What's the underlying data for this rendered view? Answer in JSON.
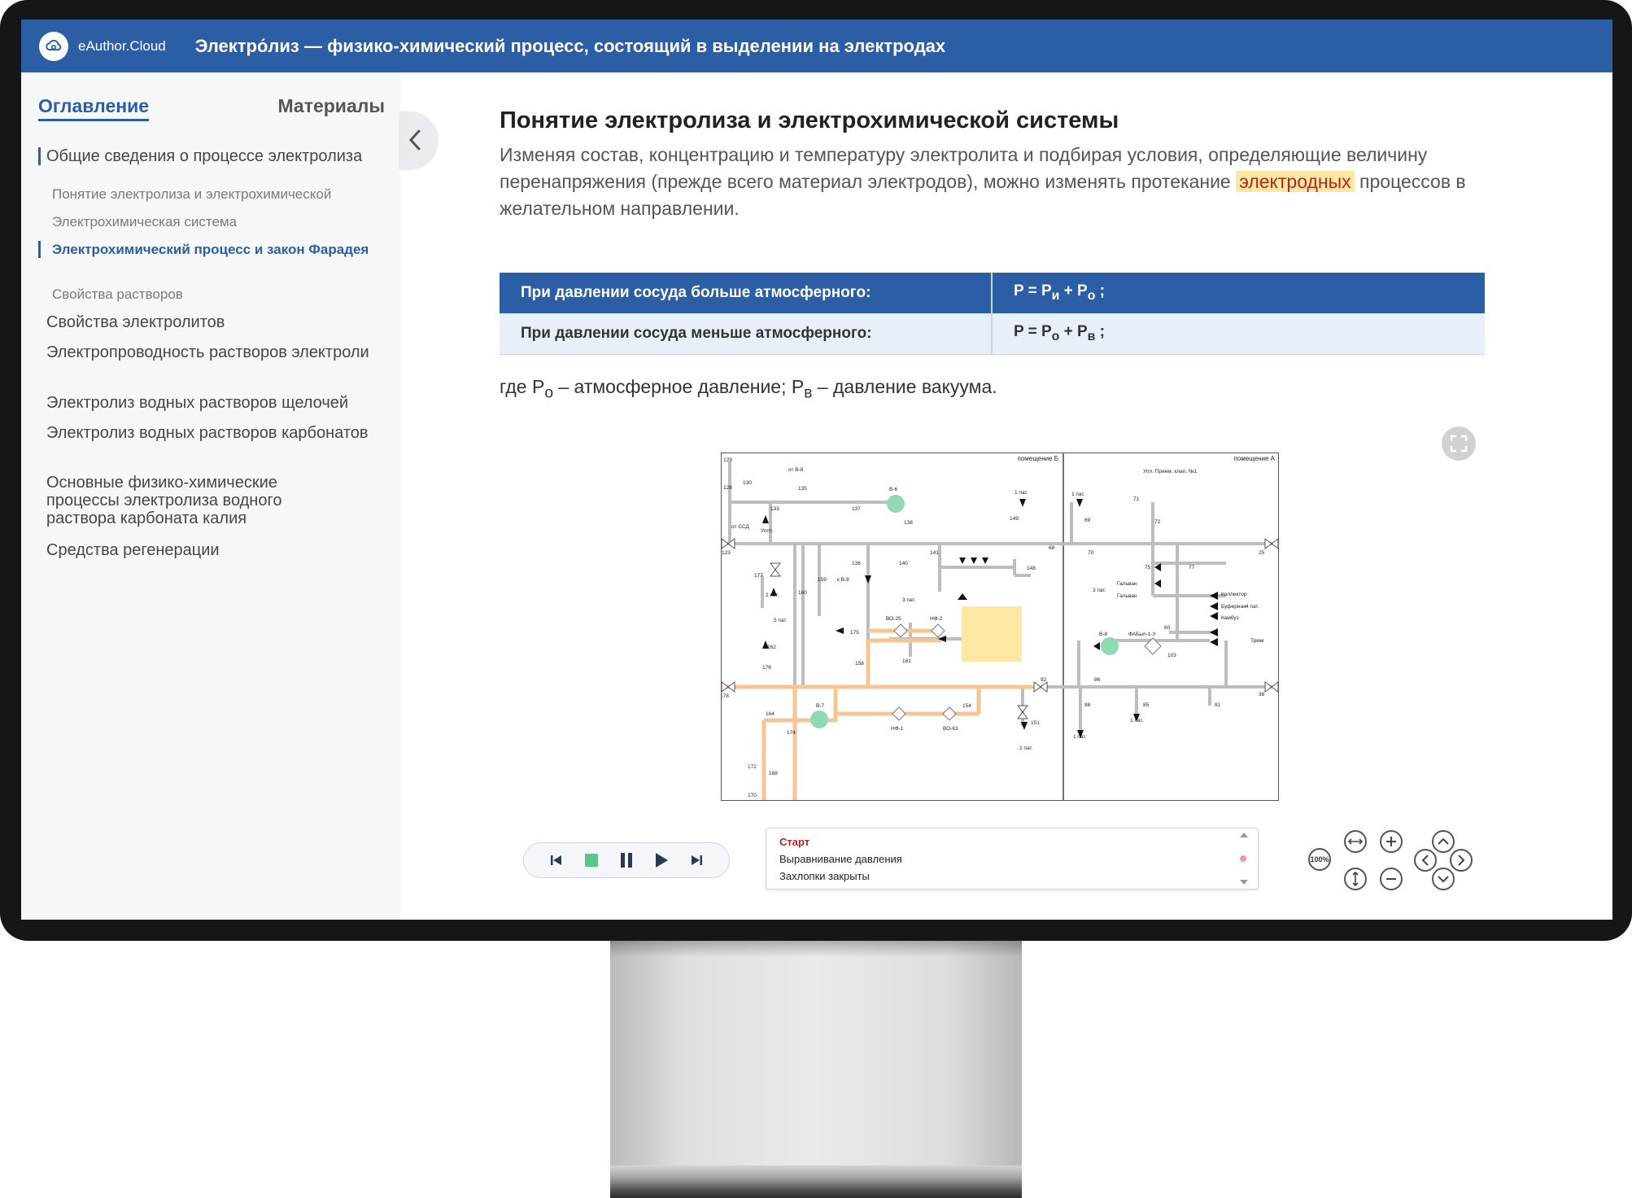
{
  "app": {
    "logo_text": "eAuthor.Cloud",
    "title": "Электро́лиз — физико-химический процесс, состоящий в выделении на электродах"
  },
  "sidebar": {
    "tabs": {
      "active": "Оглавление",
      "inactive": "Материалы"
    },
    "items": [
      {
        "label": "Общие сведения о процессе электролиза"
      },
      {
        "label": "Понятие электролиза и электрохимической"
      },
      {
        "label": "Электрохимическая система"
      },
      {
        "label": "Электрохимический процесс и закон Фарадея"
      },
      {
        "label": "Свойства растворов"
      },
      {
        "label": "Свойства электролитов"
      },
      {
        "label": "Электропроводность растворов электроли"
      },
      {
        "label": "Электролиз водных растворов щелочей"
      },
      {
        "label": "Электролиз водных растворов карбонатов"
      },
      {
        "label": "Основные физико-химические процессы электролиза водного раствора карбоната калия"
      },
      {
        "label": "Средства регенерации"
      }
    ]
  },
  "content": {
    "heading": "Понятие электролиза и электрохимической системы",
    "para_before": "Изменяя состав, концентрацию и температуру электролита и подбирая условия, определяющие величину перенапряжения (прежде всего материал электродов), можно изменять протекание ",
    "para_highlight": "электродных",
    "para_after": " процессов в желательном направлении.",
    "table": {
      "rows": [
        {
          "label": "При давлении сосуда больше атмосферного:",
          "formula_main": "P = P",
          "sub1": "и",
          "plus": " + P",
          "sub2": "o",
          "end": " ;"
        },
        {
          "label": "При давлении сосуда меньше атмосферного:",
          "formula_main": "P = P",
          "sub1": "o",
          "plus": " + P",
          "sub2": "в",
          "end": " ;"
        }
      ]
    },
    "where": {
      "t1": "где P",
      "s1": "o",
      "t2": " – атмосферное давление; P",
      "s2": "в",
      "t3": " – давление вакуума."
    }
  },
  "scheme": {
    "room_b": "помещение Б",
    "room_a": "помещение А",
    "labels": [
      "129",
      "130",
      "от В-8",
      "135",
      "128",
      "133",
      "от ССД",
      "Уплт.",
      "137",
      "В-6",
      "138",
      "1 пат.",
      "149",
      "68",
      "123",
      "141",
      "136",
      "140",
      "148",
      "177",
      "159",
      "к В-8",
      "2 пат.",
      "160",
      "5 пат.",
      "3 пат.",
      "175",
      "ВО-25",
      "НФ-2",
      "158",
      "161",
      "162",
      "176",
      "178",
      "92",
      "В-7",
      "164",
      "174",
      "НФ-1",
      "ВО-63",
      "154",
      "151",
      "2 пат.",
      "172",
      "168",
      "170",
      "1 пат.",
      "69",
      "Упл. Прием. клап. №1",
      "71",
      "72",
      "70",
      "25",
      "75",
      "77",
      "Гальван",
      "Гальван",
      "3 пат.",
      "60",
      "В-8",
      "ФАБып-1-У",
      "103",
      "Коллектор",
      "Буферная",
      "Камбуз",
      "4 пат.",
      "Трюм",
      "86",
      "88",
      "85",
      "81",
      "38",
      "1 пат.",
      "1 пат."
    ]
  },
  "player": {
    "steps": [
      "Старт",
      "Выравнивание давления",
      "Захлопки закрыты"
    ],
    "zoom_label": "100%"
  },
  "colors": {
    "brand": "#2c5ea5",
    "highlight_bg": "#fde8a3",
    "highlight_text": "#b3261e",
    "pipe_orange": "#f7c594",
    "tank_yellow": "#fde8a3",
    "valve_green": "#8fd9b6"
  }
}
